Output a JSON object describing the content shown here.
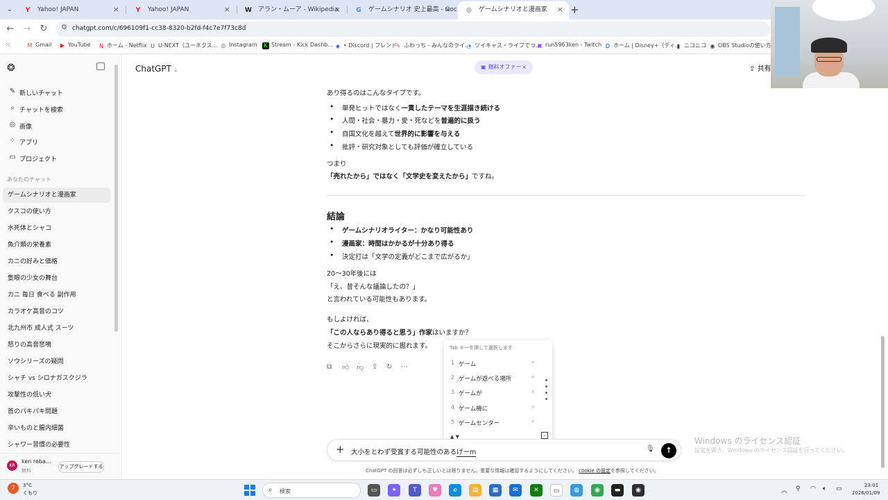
{
  "browser": {
    "tabs": [
      {
        "label": "Yahoo! JAPAN",
        "icon": "Y",
        "icon_color": "#ff0033"
      },
      {
        "label": "Yahoo! JAPAN",
        "icon": "Y",
        "icon_color": "#ff0033"
      },
      {
        "label": "アラン・ムーア - Wikipedia",
        "icon": "W",
        "icon_color": "#222222"
      },
      {
        "label": "ゲームシナリオ 史上最高 - Google",
        "icon": "G",
        "icon_color": "#4285f4"
      },
      {
        "label": "ゲームシナリオと漫画家",
        "icon": "◎",
        "icon_color": "#222222"
      }
    ],
    "active_tab": 4,
    "url": "chatgpt.com/c/696109f1-cc38-8320-b2fd-f4c7e7f73c8d",
    "bookmarks": [
      {
        "label": "Gmail",
        "icon": "M",
        "color": "#ea4335"
      },
      {
        "label": "YouTube",
        "icon": "▶",
        "color": "#ff0000"
      },
      {
        "label": "ホーム - Netflix",
        "icon": "N",
        "color": "#e50914"
      },
      {
        "label": "U-NEXT（ユーネクス...",
        "icon": "U",
        "color": "#222222"
      },
      {
        "label": "Instagram",
        "icon": "◎",
        "color": "#d62976"
      },
      {
        "label": "Stream - Kick Dashb...",
        "icon": "K",
        "color": "#53fc18"
      },
      {
        "label": "• Discord | フレンド",
        "icon": "◆",
        "color": "#5865f2"
      },
      {
        "label": "ふわっち - みんなのライ...",
        "icon": "✎",
        "color": "#ff5a5a"
      },
      {
        "label": "ツイキャス・ライブでつ...",
        "icon": "◔",
        "color": "#1da1f2"
      },
      {
        "label": "run5963ken - Twitch",
        "icon": "▣",
        "color": "#9146ff"
      },
      {
        "label": "ホーム | Disney+（ディ...",
        "icon": "D",
        "color": "#113ccf"
      },
      {
        "label": "ニコニコ",
        "icon": "▮",
        "color": "#222222"
      },
      {
        "label": "OBS Studioの使い方...",
        "icon": "◉",
        "color": "#302e31"
      }
    ]
  },
  "sidebar": {
    "nav": [
      {
        "label": "新しいチャット",
        "icon": "✎"
      },
      {
        "label": "チャットを検索",
        "icon": "⌕"
      },
      {
        "label": "画像",
        "icon": "◎"
      },
      {
        "label": "アプリ",
        "icon": "⁘"
      },
      {
        "label": "プロジェクト",
        "icon": "▭"
      }
    ],
    "section_heading": "あなたのチャット",
    "chats": [
      "ゲームシナリオと漫画家",
      "クスコの使い方",
      "水死体とシャコ",
      "魚介類の栄養素",
      "カニの好みと価格",
      "隻眼の少女の舞台",
      "カニ 毎日 食べる 副作用",
      "カラオケ高音のコツ",
      "北九州市 成人式 スーツ",
      "怒りの高音悲鳴",
      "ソウシリーズの疑問",
      "シャチ vs シロナガスクジラ",
      "攻撃性の低い犬",
      "首のパキパキ問題",
      "辛いものと腸内細菌",
      "シャワー習慣の必要性"
    ],
    "active_chat": 0,
    "user": {
      "initials": "KR",
      "name": "ken reba...",
      "plan": "無料"
    },
    "upgrade_label": "アップグレードする"
  },
  "header": {
    "model": "ChatGPT",
    "offer": "無料オファー",
    "share": "共有"
  },
  "messages": {
    "intro": "あり得るのはこんなタイプです。",
    "bullets1": [
      {
        "pre": "単発ヒットではなく",
        "bold": "一貫したテーマを生涯描き続ける",
        "post": ""
      },
      {
        "pre": "人間・社会・暴力・愛・死などを",
        "bold": "普遍的に扱う",
        "post": ""
      },
      {
        "pre": "自国文化を越えて",
        "bold": "世界的に影響を与える",
        "post": ""
      },
      {
        "pre": "批評・研究対象としても評価が確立している",
        "bold": "",
        "post": ""
      }
    ],
    "tsumari": "つまり",
    "summary_bold": "「売れたから」ではなく「文学史を変えたから」",
    "summary_post": "ですね。",
    "conclusion_heading": "結論",
    "bullets2": [
      {
        "bold": "ゲームシナリオライター：かなり可能性あり",
        "post": ""
      },
      {
        "bold": "漫画家：時間はかかるが十分あり得る",
        "post": ""
      },
      {
        "bold": "",
        "post": "決定打は「文学の定義がどこまで広がるか」"
      }
    ],
    "future_1": "20〜30年後には",
    "future_2": "「え、昔そんな議論したの？」",
    "future_3": "と言われている可能性もあります。",
    "offer_1": "もしよければ、",
    "offer_2_bold": "「この人ならあり得ると思う」作家",
    "offer_2_post": "はいますか？",
    "offer_3": "そこからさらに現実的に掘れます。"
  },
  "suggestions": {
    "hint": "Tab キーを押して選択します",
    "items": [
      {
        "num": "1",
        "word": "ゲーム"
      },
      {
        "num": "2",
        "word": "ゲームが遊べる場所"
      },
      {
        "num": "3",
        "word": "ゲームが"
      },
      {
        "num": "4",
        "word": "ゲーム機に"
      },
      {
        "num": "5",
        "word": "ゲームセンター"
      }
    ],
    "nav": "▲ ▼"
  },
  "composer": {
    "text": "大小をとわず受賞する可能性のある",
    "ime_text": "げーm",
    "disclaimer_pre": "ChatGPT の回答は必ずしも正しいとは限りません。重要な情報は確認するようにしてください。",
    "disclaimer_link": "cookie の設定",
    "disclaimer_post": "を参照してください。"
  },
  "watermark": {
    "title": "Windows のライセンス認証",
    "subtitle": "設定を開き、Windows のライセンス認証を行ってください。"
  },
  "taskbar": {
    "weather_badge": "7",
    "weather_temp": "3°C",
    "weather_desc": "くもり",
    "search_placeholder": "検索",
    "time": "23:01",
    "date": "2026/01/09"
  }
}
